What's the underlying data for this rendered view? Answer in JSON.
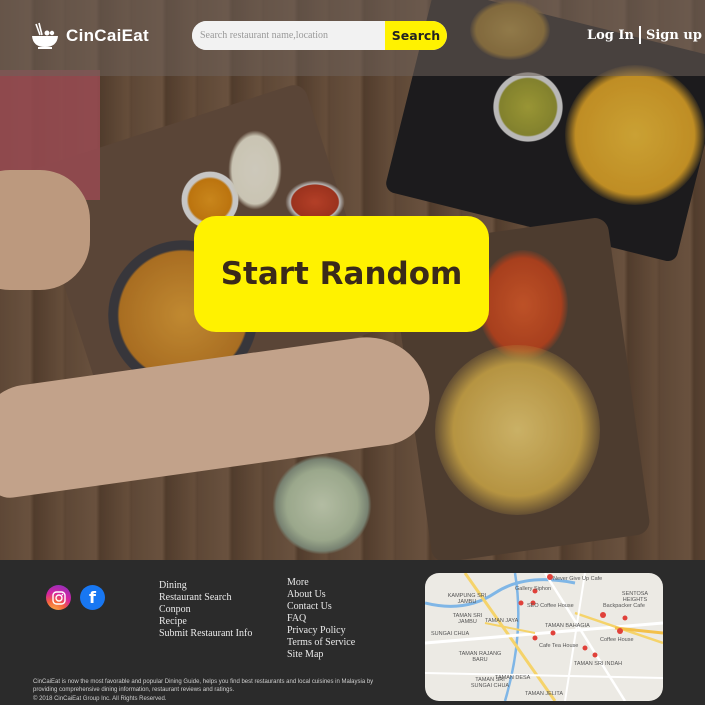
{
  "brand": {
    "name": "CinCaiEat",
    "logo_icon": "food-bowl-icon"
  },
  "search": {
    "placeholder": "Search restaurant name,location",
    "button_label": "Search"
  },
  "auth": {
    "login_label": "Log In",
    "signup_label": "Sign up"
  },
  "hero": {
    "cta_label": "Start Random"
  },
  "footer": {
    "social": [
      {
        "name": "instagram-icon"
      },
      {
        "name": "facebook-icon",
        "glyph": "f"
      }
    ],
    "links_col1": [
      "Dining",
      "Restaurant Search",
      "Conpon",
      "Recipe",
      "Submit Restaurant Info"
    ],
    "links_col2": [
      "More",
      "About Us",
      "Contact Us",
      "FAQ",
      "Privacy Policy",
      "Terms of Service",
      "Site Map"
    ],
    "about": "CinCaiEat is now the most favorable and popular Dining Guide, helps you find best restaurants and local cuisines in Malaysia by providing comprehensive dining information, restaurant reviews and ratings.",
    "copyright": "© 2018 CinCaiEat Group Inc. All Rights Reserved."
  },
  "map": {
    "places": [
      "Never Give Up Cafe",
      "Gallery Siphon",
      "SEO Coffee House",
      "Cafe Tea House",
      "Backpacker Cafe",
      "Coffee House"
    ],
    "areas": [
      "KAMPUNG SRI JAMBU",
      "TAMAN SRI JAMBU",
      "TAMAN JAYA",
      "TAMAN BAHAGIA",
      "SENTOSA HEIGHTS",
      "SUNGAI CHUA",
      "TAMAN RAJANG BARU",
      "TAMAN DESA",
      "TAMAN SRI INDAH",
      "TAMAN JELITA",
      "TAMAN SRI SUNGAI CHUA"
    ]
  },
  "colors": {
    "accent": "#fff200",
    "footer_bg": "#2b2b2b",
    "facebook": "#1877f2"
  }
}
